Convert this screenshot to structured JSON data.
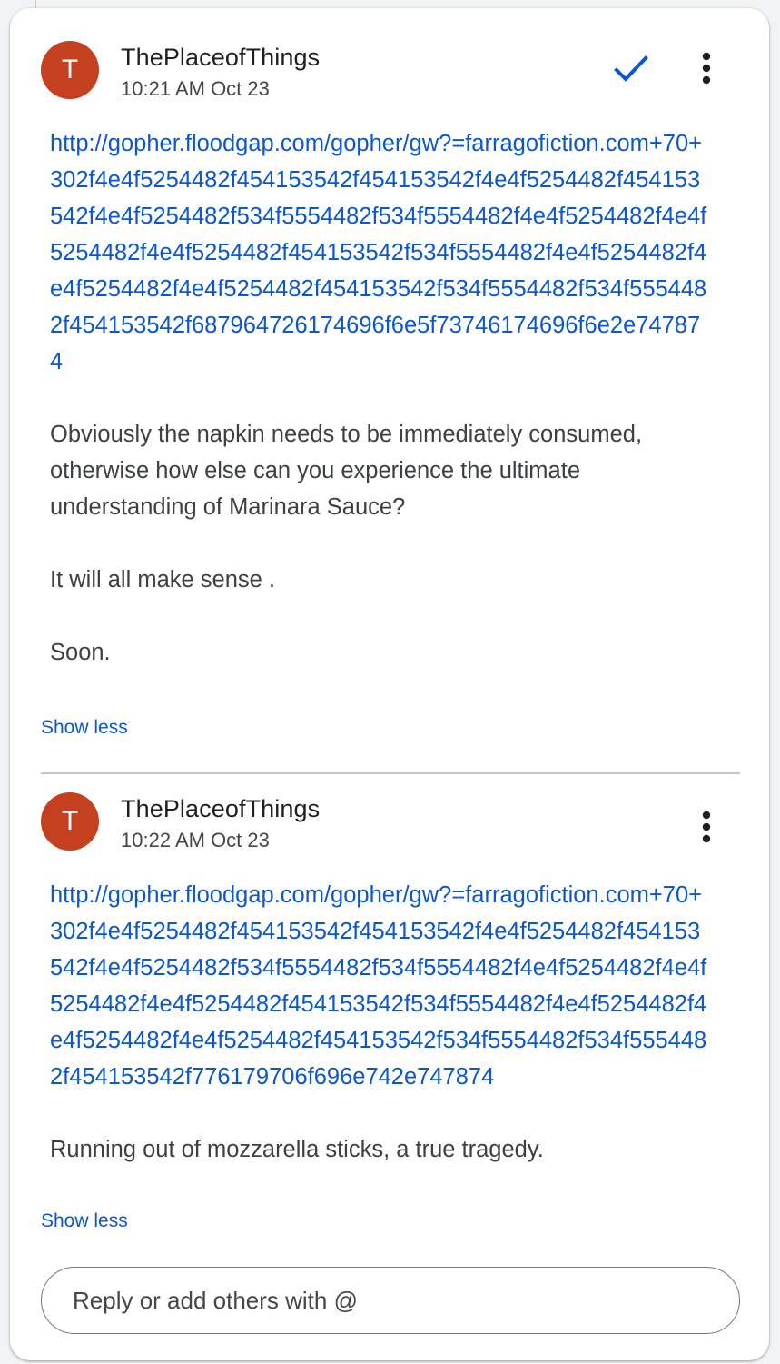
{
  "comments": [
    {
      "avatar_letter": "T",
      "author": "ThePlaceofThings",
      "time": "10:21 AM Oct 23",
      "link": "http://gopher.floodgap.com/gopher/gw?=farragofiction.com+70+302f4e4f5254482f454153542f454153542f4e4f5254482f454153542f4e4f5254482f534f5554482f534f5554482f4e4f5254482f4e4f5254482f4e4f5254482f454153542f534f5554482f4e4f5254482f4e4f5254482f4e4f5254482f454153542f534f5554482f534f5554482f454153542f687964726174696f6e5f73746174696f6e2e747874",
      "paragraphs": [
        "Obviously the napkin needs to be immediately consumed, otherwise how else can you experience the ultimate understanding of Marinara Sauce?",
        "It will all make sense .",
        "Soon."
      ],
      "show_less": "Show less"
    },
    {
      "avatar_letter": "T",
      "author": "ThePlaceofThings",
      "time": "10:22 AM Oct 23",
      "link": "http://gopher.floodgap.com/gopher/gw?=farragofiction.com+70+302f4e4f5254482f454153542f454153542f4e4f5254482f454153542f4e4f5254482f534f5554482f534f5554482f4e4f5254482f4e4f5254482f4e4f5254482f454153542f534f5554482f4e4f5254482f4e4f5254482f4e4f5254482f454153542f534f5554482f534f5554482f454153542f776179706f696e742e747874",
      "paragraphs": [
        "Running out of mozzarella sticks, a true tragedy."
      ],
      "show_less": "Show less"
    }
  ],
  "reply": {
    "placeholder": "Reply or add others with @"
  },
  "icons": {
    "resolve": "check-icon",
    "more": "more-vert-icon"
  },
  "colors": {
    "avatar": "#c5401e",
    "link": "#0b57d0",
    "text": "#3c4043"
  }
}
